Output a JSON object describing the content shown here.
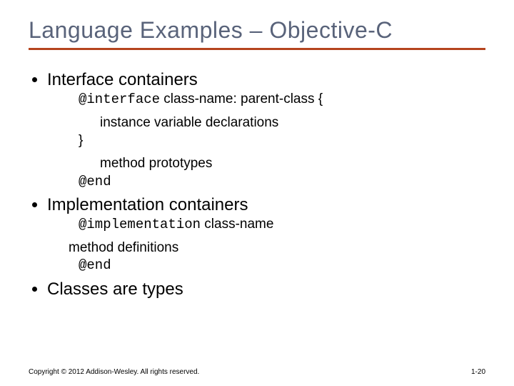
{
  "title": "Language Examples – Objective-C",
  "bullets": {
    "b1": "Interface containers",
    "b2": "Implementation containers",
    "b3": "Classes are types"
  },
  "interface_block": {
    "kw_interface": "@interface",
    "header_rest": " class-name: parent-class {",
    "ivar_line": "instance variable declarations",
    "close_brace": "}",
    "methods_line": "method prototypes",
    "kw_end": "@end"
  },
  "impl_block": {
    "kw_impl": "@implementation",
    "header_rest": " class-name",
    "methods_line": "method definitions",
    "kw_end": "@end"
  },
  "footer": {
    "copyright": "Copyright © 2012 Addison-Wesley. All rights reserved.",
    "page": "1-20"
  }
}
